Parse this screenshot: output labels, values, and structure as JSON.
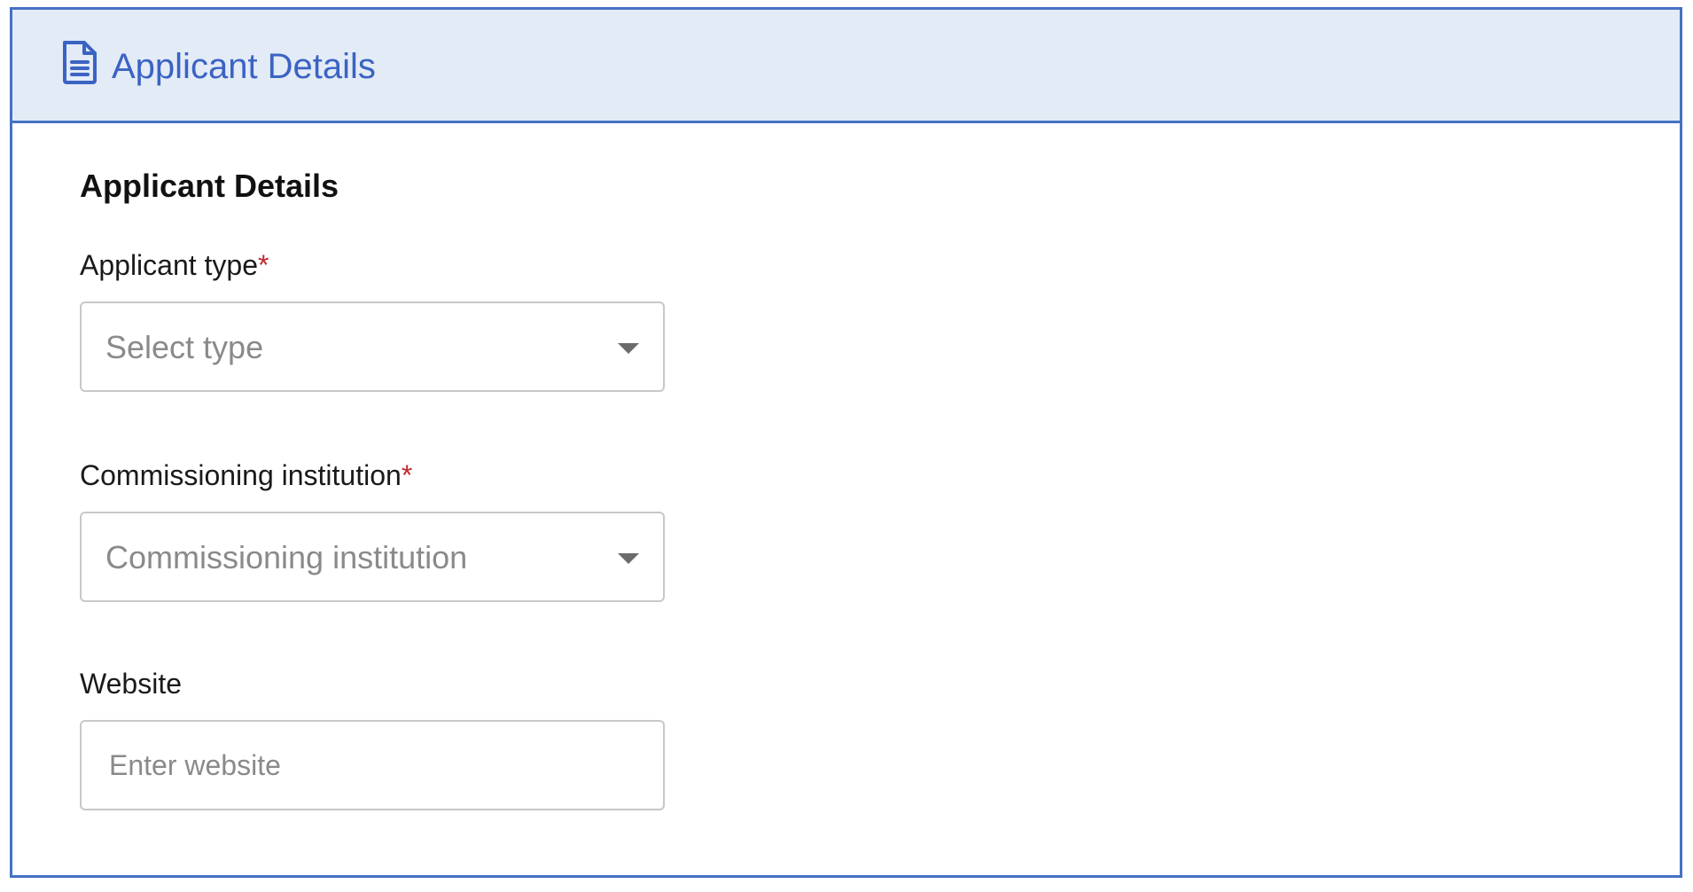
{
  "header": {
    "icon": "document-icon",
    "title": "Applicant Details"
  },
  "section": {
    "title": "Applicant Details"
  },
  "fields": {
    "applicant_type": {
      "label": "Applicant type",
      "required_mark": "*",
      "placeholder": "Select type"
    },
    "commissioning_institution": {
      "label": "Commissioning institution",
      "required_mark": "*",
      "placeholder": "Commissioning institution"
    },
    "website": {
      "label": "Website",
      "placeholder": "Enter website",
      "value": ""
    }
  },
  "colors": {
    "accent": "#4472c4",
    "header_bg": "#e3ebf6",
    "title_blue": "#3b63c4",
    "required_red": "#c0292f"
  }
}
